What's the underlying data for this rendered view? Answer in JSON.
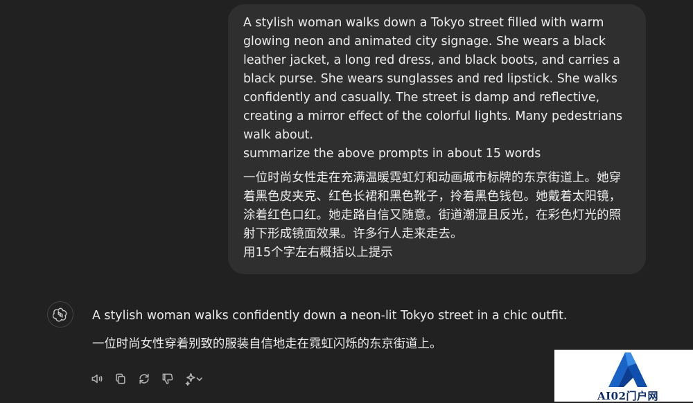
{
  "user_message": {
    "english": "A stylish woman walks down a Tokyo street filled with warm\nglowing neon and animated city signage. She wears a black\nleather jacket, a long red dress, and black boots, and carries a\nblack purse. She wears sunglasses and red lipstick. She walks\nconfidently and casually. The street is damp and reflective,\ncreating a mirror effect of the colorful lights. Many pedestrians\nwalk about.\nsummarize the above prompts in about 15 words",
    "chinese": "一位时尚女性走在充满温暖霓虹灯和动画城市标牌的东京街道上。她穿\n着黑色皮夹克、红色长裙和黑色靴子，拎着黑色钱包。她戴着太阳镜，\n涂着红色口红。她走路自信又随意。街道潮湿且反光，在彩色灯光的照\n射下形成镜面效果。许多行人走来走去。\n用15个字左右概括以上提示"
  },
  "assistant_message": {
    "english": "A stylish woman walks confidently down a neon-lit Tokyo street in a chic outfit.",
    "chinese": "一位时尚女性穿着别致的服装自信地走在霓虹闪烁的东京街道上。"
  },
  "actions": [
    {
      "icon": "speaker-icon"
    },
    {
      "icon": "copy-icon"
    },
    {
      "icon": "regenerate-icon"
    },
    {
      "icon": "thumbs-down-icon"
    },
    {
      "icon": "sparkle-model-icon"
    }
  ],
  "watermark": {
    "text": "AI02门户网"
  },
  "colors": {
    "background": "#212121",
    "bubble": "#2f2f2f",
    "text": "#ececec",
    "icon": "#b4b4b4"
  }
}
